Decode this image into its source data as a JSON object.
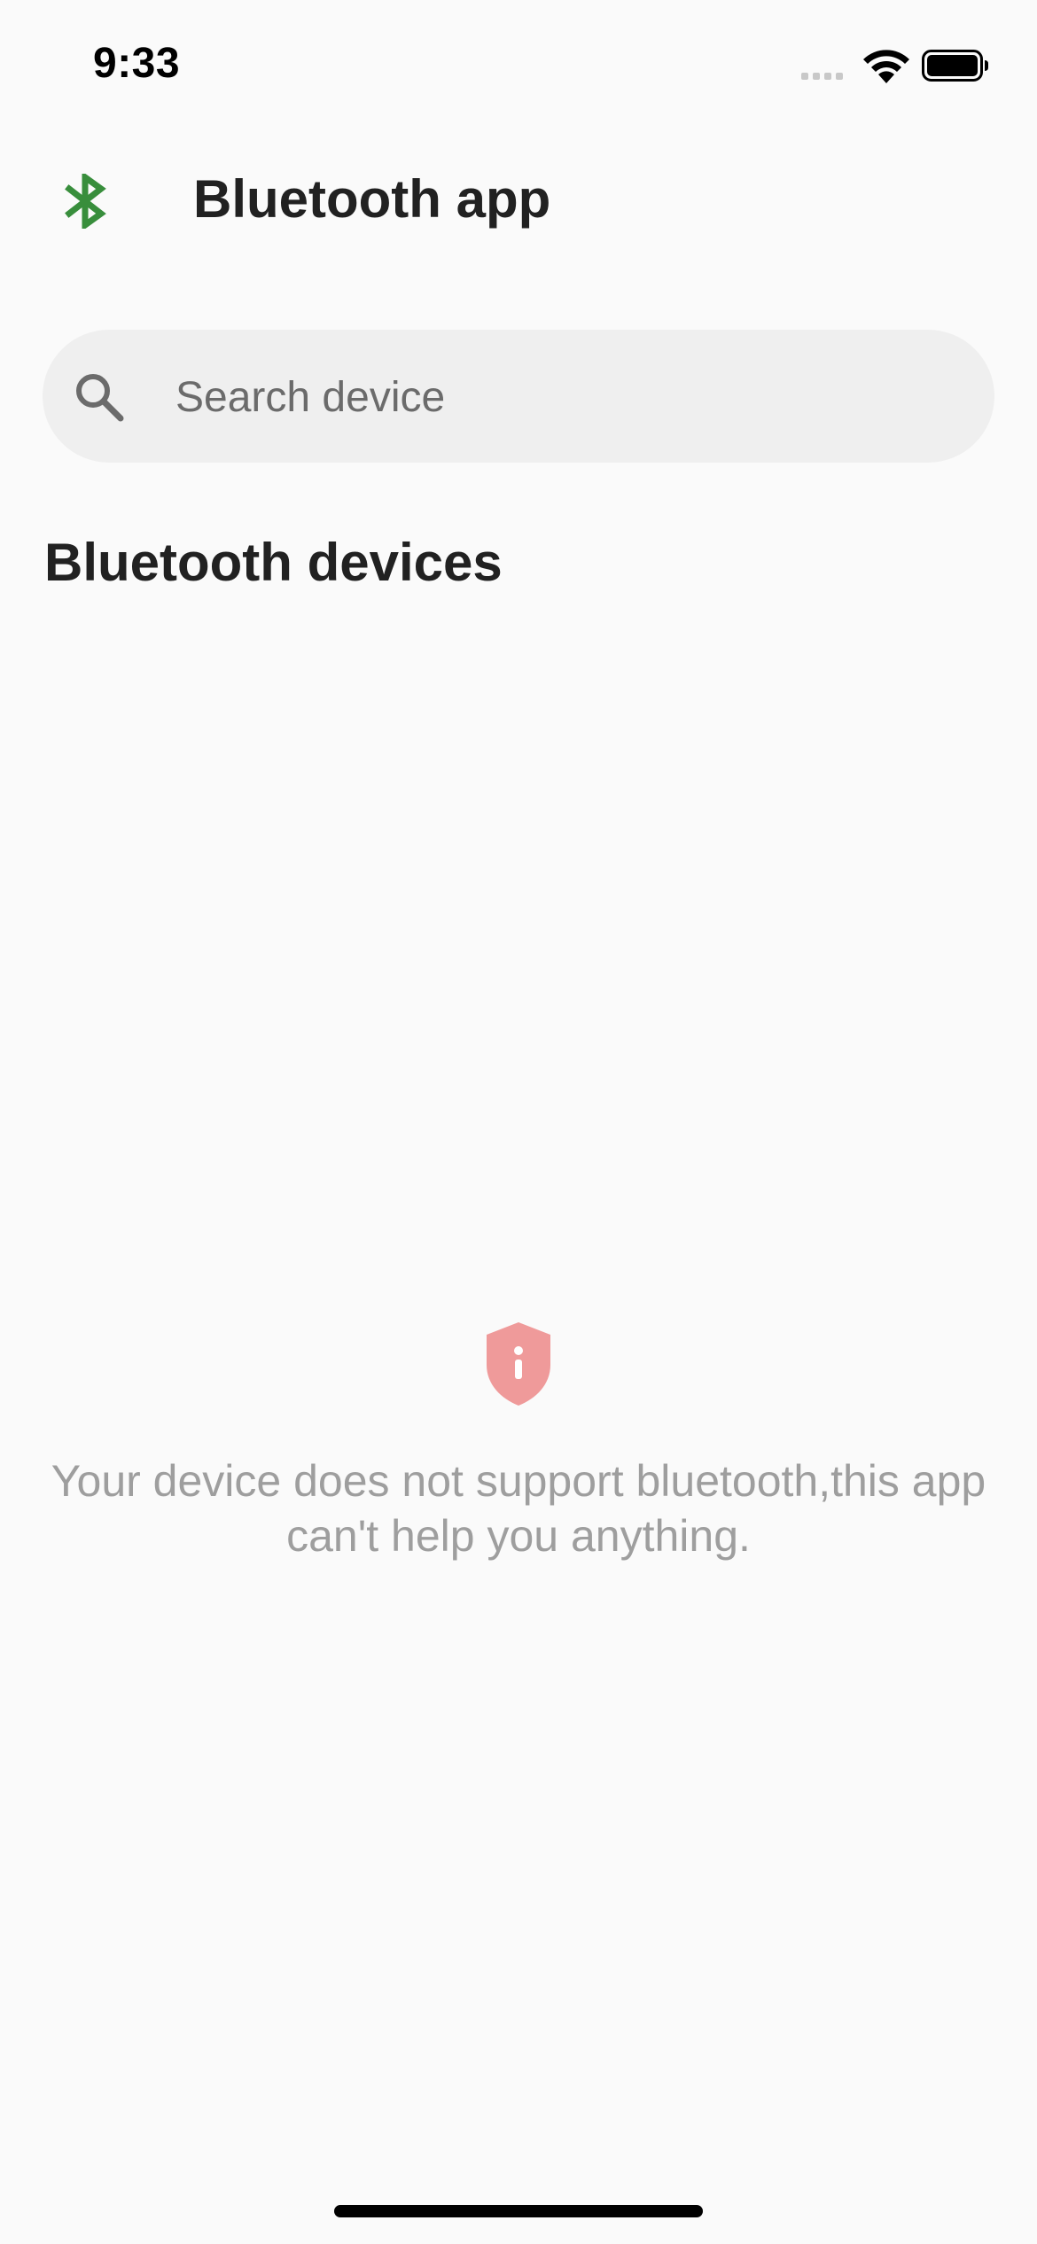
{
  "status_bar": {
    "time": "9:33"
  },
  "app_bar": {
    "title": "Bluetooth app",
    "logo_icon": "bluetooth-icon",
    "logo_color": "#388e3c"
  },
  "search": {
    "placeholder": "Search device",
    "value": "",
    "icon": "search-icon"
  },
  "section": {
    "heading": "Bluetooth devices"
  },
  "empty_state": {
    "icon": "shield-info-icon",
    "icon_color": "#ef9a9a",
    "message": "Your device does not support bluetooth,this app can't help you anything."
  }
}
